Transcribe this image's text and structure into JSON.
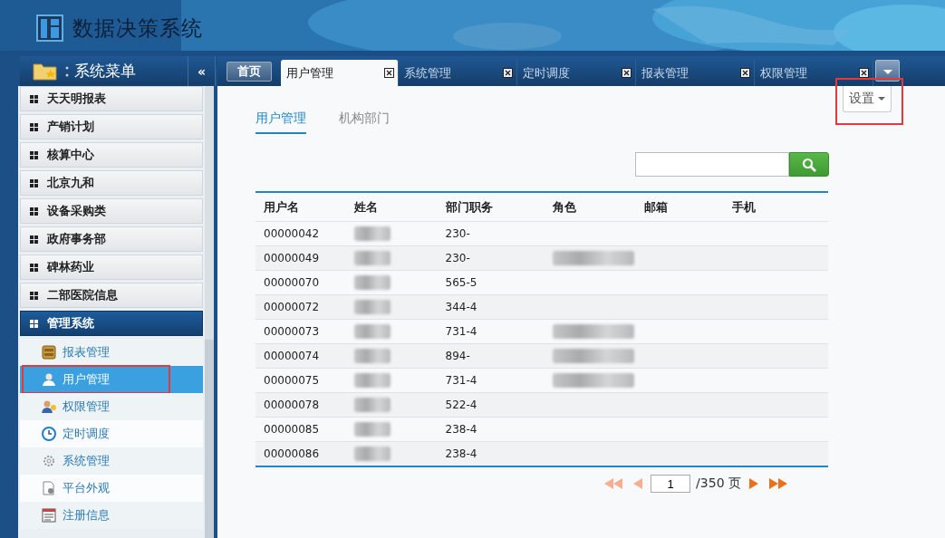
{
  "header": {
    "title": "数据决策系统"
  },
  "sidebar": {
    "title": "系统菜单",
    "collapse": "«",
    "groups": [
      {
        "label": "天天明报表",
        "expanded": false
      },
      {
        "label": "产销计划",
        "expanded": false
      },
      {
        "label": "核算中心",
        "expanded": false
      },
      {
        "label": "北京九和",
        "expanded": false
      },
      {
        "label": "设备采购类",
        "expanded": false
      },
      {
        "label": "政府事务部",
        "expanded": false
      },
      {
        "label": "碑林药业",
        "expanded": false
      },
      {
        "label": "二部医院信息",
        "expanded": false
      },
      {
        "label": "管理系统",
        "expanded": true,
        "children": [
          {
            "label": "报表管理",
            "kind": "cabinet",
            "selected": false,
            "highlighted": false
          },
          {
            "label": "用户管理",
            "kind": "user",
            "selected": true,
            "highlighted": true
          },
          {
            "label": "权限管理",
            "kind": "users",
            "selected": false,
            "highlighted": false
          },
          {
            "label": "定时调度",
            "kind": "clock",
            "selected": false,
            "highlighted": false
          },
          {
            "label": "系统管理",
            "kind": "gear",
            "selected": false,
            "highlighted": false
          },
          {
            "label": "平台外观",
            "kind": "page",
            "selected": false,
            "highlighted": false
          },
          {
            "label": "注册信息",
            "kind": "form",
            "selected": false,
            "highlighted": false
          }
        ]
      }
    ]
  },
  "tabs": {
    "home": "首页",
    "items": [
      {
        "label": "用户管理",
        "selected": true
      },
      {
        "label": "系统管理",
        "selected": false
      },
      {
        "label": "定时调度",
        "selected": false
      },
      {
        "label": "报表管理",
        "selected": false
      },
      {
        "label": "权限管理",
        "selected": false
      }
    ]
  },
  "settings": {
    "label": "设置",
    "highlighted": true
  },
  "subtabs": [
    {
      "label": "用户管理",
      "selected": true
    },
    {
      "label": "机构部门",
      "selected": false
    }
  ],
  "table": {
    "columns": [
      "用户名",
      "姓名",
      "部门职务",
      "角色",
      "邮箱",
      "手机"
    ],
    "rows": [
      {
        "id": "00000042",
        "dept": "230-",
        "role_redacted": false
      },
      {
        "id": "00000049",
        "dept": "230-",
        "role_redacted": true
      },
      {
        "id": "00000070",
        "dept": "565-5",
        "role_redacted": false
      },
      {
        "id": "00000072",
        "dept": "344-4",
        "role_redacted": false
      },
      {
        "id": "00000073",
        "dept": "731-4",
        "role_redacted": true
      },
      {
        "id": "00000074",
        "dept": "894-",
        "role_redacted": true
      },
      {
        "id": "00000075",
        "dept": "731-4",
        "role_redacted": true
      },
      {
        "id": "00000078",
        "dept": "522-4",
        "role_redacted": false
      },
      {
        "id": "00000085",
        "dept": "238-4",
        "role_redacted": false
      },
      {
        "id": "00000086",
        "dept": "238-4",
        "role_redacted": false
      }
    ]
  },
  "pager": {
    "page": "1",
    "total": "/350 页"
  }
}
